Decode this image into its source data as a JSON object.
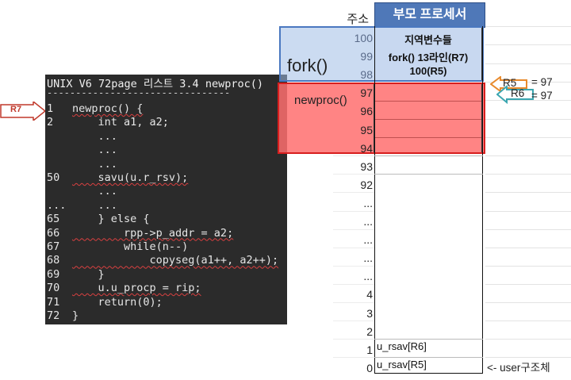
{
  "code": {
    "title": "UNIX V6 72page 리스트 3.4 newproc()",
    "separator": "--------------------------------",
    "lines": [
      {
        "num": "1",
        "text": "newproc() {"
      },
      {
        "num": "2",
        "text": "    int a1, a2;"
      },
      {
        "num": "",
        "text": "    ..."
      },
      {
        "num": "",
        "text": "    ..."
      },
      {
        "num": "",
        "text": "    ..."
      },
      {
        "num": "50",
        "text": "    savu(u.r_rsv);"
      },
      {
        "num": "",
        "text": "    ..."
      },
      {
        "num": "...",
        "text": "    ..."
      },
      {
        "num": "65",
        "text": "    } else {"
      },
      {
        "num": "66",
        "text": "        rpp->p_addr = a2;"
      },
      {
        "num": "67",
        "text": "        while(n--)"
      },
      {
        "num": "68",
        "text": "            copyseg(a1++, a2++);"
      },
      {
        "num": "69",
        "text": "    }"
      },
      {
        "num": "70",
        "text": "    u.u_procp = rip;"
      },
      {
        "num": "71",
        "text": "    return(0);"
      },
      {
        "num": "72",
        "text": "}"
      }
    ]
  },
  "pointer_r7": "R7",
  "memory": {
    "address_header": "주소",
    "process_header": "부모 프로세서",
    "fork_label": "fork()",
    "newproc_label": "newproc()",
    "fork_cell": [
      "지역변수들",
      "fork() 13라인(R7)",
      "100(R5)"
    ],
    "addresses": [
      "100",
      "99",
      "98",
      "97",
      "96",
      "95",
      "94",
      "93",
      "92",
      "...",
      "...",
      "...",
      "...",
      "...",
      "4",
      "3",
      "2",
      "1",
      "0"
    ],
    "cell_1": "u_rsav[R6]",
    "cell_0": "u_rsav[R5]",
    "user_struct_note": "<- user구조체"
  },
  "registers": {
    "r5_label": "R5",
    "r5_value": "= 97",
    "r6_label": "R6",
    "r6_value": "= 97"
  }
}
